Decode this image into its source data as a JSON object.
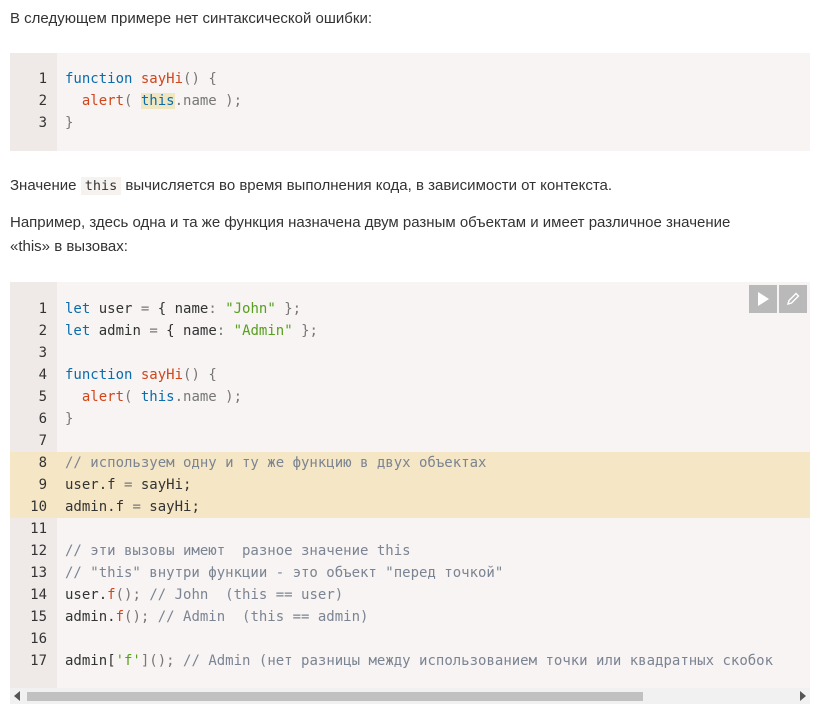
{
  "paragraphs": {
    "p1": "В следующем примере нет синтаксической ошибки:",
    "p2_before": "Значение ",
    "p2_code": "this",
    "p2_after": " вычисляется во время выполнения кода, в зависимости от контекста.",
    "p3_line1": "Например, здесь одна и та же функция назначена двум разным объектам и имеет различное значение",
    "p3_line2": "«this» в вызовах:"
  },
  "code1": {
    "lines": [
      {
        "n": "1",
        "t": [
          [
            "function",
            "kw"
          ],
          [
            " ",
            ""
          ],
          [
            "sayHi",
            "fn"
          ],
          [
            "() {",
            "pn"
          ]
        ]
      },
      {
        "n": "2",
        "t": [
          [
            "  ",
            ""
          ],
          [
            "alert",
            "fn"
          ],
          [
            "( ",
            "pn"
          ],
          [
            "this",
            "kw thisbg"
          ],
          [
            ".name );",
            "pn"
          ]
        ]
      },
      {
        "n": "3",
        "t": [
          [
            "}",
            "pn"
          ]
        ]
      }
    ]
  },
  "code2": {
    "run_icon": "play-icon",
    "edit_icon": "pencil-icon",
    "highlight_lines": [
      "8",
      "9",
      "10"
    ],
    "lines": [
      {
        "n": "1",
        "t": [
          [
            "let",
            "kw"
          ],
          [
            " user ",
            ""
          ],
          [
            "=",
            "pn"
          ],
          [
            " { name",
            ""
          ],
          [
            ":",
            "pn"
          ],
          [
            " ",
            ""
          ],
          [
            "\"John\"",
            "str"
          ],
          [
            " };",
            "pn"
          ]
        ]
      },
      {
        "n": "2",
        "t": [
          [
            "let",
            "kw"
          ],
          [
            " admin ",
            ""
          ],
          [
            "=",
            "pn"
          ],
          [
            " { name",
            ""
          ],
          [
            ":",
            "pn"
          ],
          [
            " ",
            ""
          ],
          [
            "\"Admin\"",
            "str"
          ],
          [
            " };",
            "pn"
          ]
        ]
      },
      {
        "n": "3",
        "t": []
      },
      {
        "n": "4",
        "t": [
          [
            "function",
            "kw"
          ],
          [
            " ",
            ""
          ],
          [
            "sayHi",
            "fn"
          ],
          [
            "() {",
            "pn"
          ]
        ]
      },
      {
        "n": "5",
        "t": [
          [
            "  ",
            ""
          ],
          [
            "alert",
            "fn"
          ],
          [
            "( ",
            "pn"
          ],
          [
            "this",
            "kw"
          ],
          [
            ".name );",
            "pn"
          ]
        ]
      },
      {
        "n": "6",
        "t": [
          [
            "}",
            "pn"
          ]
        ]
      },
      {
        "n": "7",
        "t": []
      },
      {
        "n": "8",
        "t": [
          [
            "// используем одну и ту же функцию в двух объектах",
            "cm"
          ]
        ]
      },
      {
        "n": "9",
        "t": [
          [
            "user.f ",
            ""
          ],
          [
            "=",
            "pn"
          ],
          [
            " sayHi;",
            ""
          ]
        ]
      },
      {
        "n": "10",
        "t": [
          [
            "admin.f ",
            ""
          ],
          [
            "=",
            "pn"
          ],
          [
            " sayHi;",
            ""
          ]
        ]
      },
      {
        "n": "11",
        "t": []
      },
      {
        "n": "12",
        "t": [
          [
            "// эти вызовы имеют  разное значение this",
            "cm"
          ]
        ]
      },
      {
        "n": "13",
        "t": [
          [
            "// \"this\" внутри функции - это объект \"перед точкой\"",
            "cm"
          ]
        ]
      },
      {
        "n": "14",
        "t": [
          [
            "user.",
            ""
          ],
          [
            "f",
            "fn"
          ],
          [
            "(); ",
            "pn"
          ],
          [
            "// John  (this == user)",
            "cm"
          ]
        ]
      },
      {
        "n": "15",
        "t": [
          [
            "admin.",
            ""
          ],
          [
            "f",
            "fn"
          ],
          [
            "(); ",
            "pn"
          ],
          [
            "// Admin  (this == admin)",
            "cm"
          ]
        ]
      },
      {
        "n": "16",
        "t": []
      },
      {
        "n": "17",
        "t": [
          [
            "admin[",
            ""
          ],
          [
            "'f'",
            "str"
          ],
          [
            "](); ",
            "pn"
          ],
          [
            "// Admin (нет разницы между использованием точки или квадратных скобок",
            "cm"
          ]
        ]
      }
    ]
  }
}
